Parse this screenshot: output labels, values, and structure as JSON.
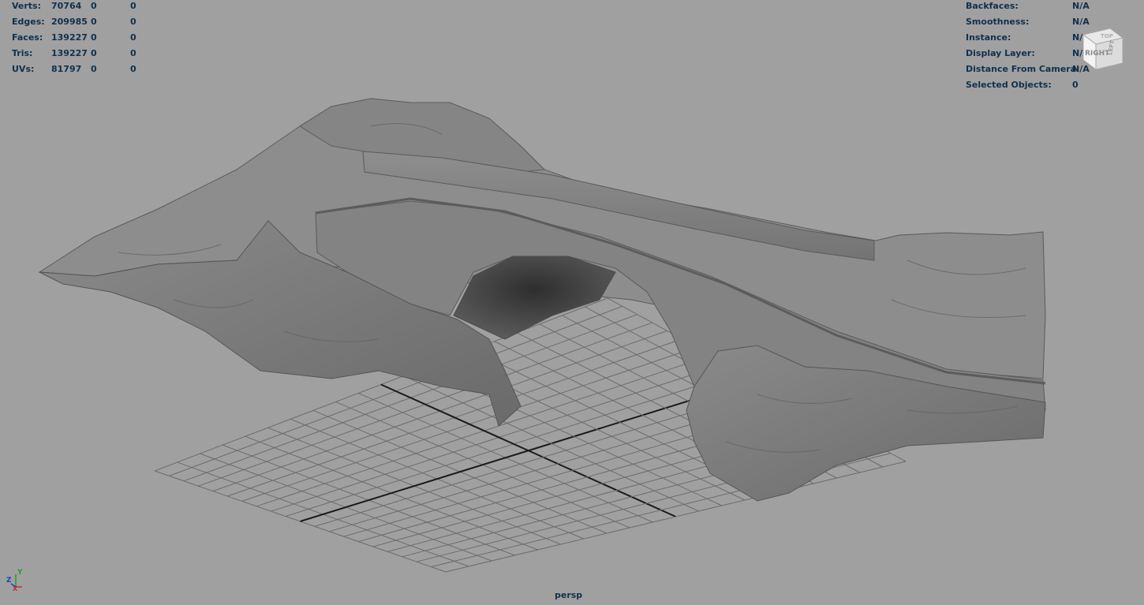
{
  "stats": [
    {
      "label": "Verts:",
      "values": [
        "70764",
        "0",
        "0"
      ]
    },
    {
      "label": "Edges:",
      "values": [
        "209985",
        "0",
        "0"
      ]
    },
    {
      "label": "Faces:",
      "values": [
        "139227",
        "0",
        "0"
      ]
    },
    {
      "label": "Tris:",
      "values": [
        "139227",
        "0",
        "0"
      ]
    },
    {
      "label": "UVs:",
      "values": [
        "81797",
        "0",
        "0"
      ]
    }
  ],
  "info": [
    {
      "label": "Backfaces:",
      "value": "N/A"
    },
    {
      "label": "Smoothness:",
      "value": "N/A"
    },
    {
      "label": "Instance:",
      "value": "N/A"
    },
    {
      "label": "Display Layer:",
      "value": "N/A"
    },
    {
      "label": "Distance From Camera:",
      "value": "N/A"
    },
    {
      "label": "Selected Objects:",
      "value": "0"
    }
  ],
  "camera_label": "persp",
  "view_cube": {
    "front_face": "RIGHT",
    "side_face": "LEFT",
    "top_face": "TOP"
  },
  "axis_gizmo": {
    "x": "X",
    "y": "Y",
    "z": "Z"
  },
  "colors": {
    "viewport_bg": "#a0a0a0",
    "hud_text": "#12304a",
    "grid": "#6c6c6c",
    "axis_line": "#1a1a1a",
    "mesh": "#828282"
  }
}
